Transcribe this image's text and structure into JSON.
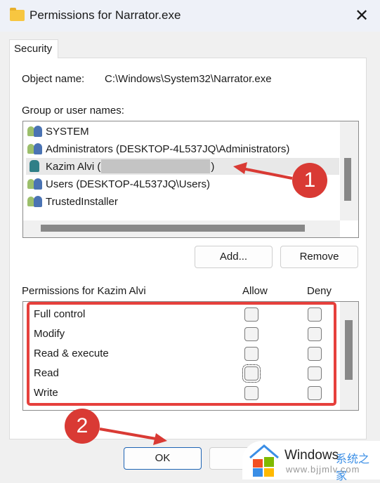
{
  "window": {
    "title": "Permissions for Narrator.exe",
    "close_icon": "close-icon"
  },
  "tab": {
    "label": "Security"
  },
  "object": {
    "label": "Object name:",
    "value": "C:\\Windows\\System32\\Narrator.exe"
  },
  "groups": {
    "label": "Group or user names:",
    "items": [
      {
        "name": "SYSTEM",
        "icon": "group-icon"
      },
      {
        "name": "Administrators (DESKTOP-4L537JQ\\Administrators)",
        "icon": "group-icon"
      },
      {
        "name": "Kazim Alvi (",
        "suffix": ")",
        "icon": "user-icon",
        "selected": true
      },
      {
        "name": "Users (DESKTOP-4L537JQ\\Users)",
        "icon": "group-icon"
      },
      {
        "name": "TrustedInstaller",
        "icon": "group-icon"
      }
    ]
  },
  "buttons": {
    "add": "Add...",
    "remove": "Remove",
    "ok": "OK",
    "cancel": "C"
  },
  "permissions": {
    "label": "Permissions for Kazim Alvi",
    "allow": "Allow",
    "deny": "Deny",
    "items": [
      {
        "name": "Full control",
        "allow": false,
        "deny": false
      },
      {
        "name": "Modify",
        "allow": false,
        "deny": false
      },
      {
        "name": "Read & execute",
        "allow": false,
        "deny": false
      },
      {
        "name": "Read",
        "allow": false,
        "deny": false
      },
      {
        "name": "Write",
        "allow": false,
        "deny": false
      }
    ]
  },
  "annotations": {
    "step1": "1",
    "step2": "2",
    "color": "#d93a34"
  },
  "watermark": {
    "brand": "Windows",
    "cn": "系统之家",
    "url": "www.bjjmlv.com"
  }
}
